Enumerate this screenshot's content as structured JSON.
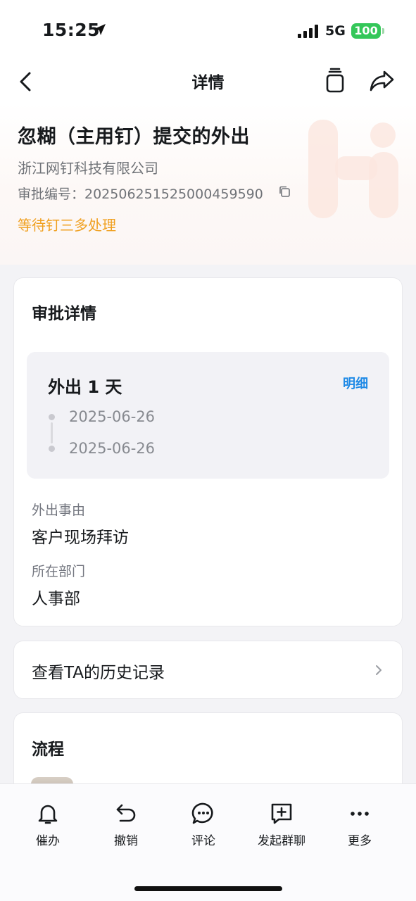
{
  "status_bar": {
    "time": "15:25",
    "network": "5G",
    "battery": "100"
  },
  "nav": {
    "title": "详情"
  },
  "header": {
    "title": "忽糊（主用钉）提交的外出",
    "company": "浙江网钉科技有限公司",
    "approval_number": "审批编号：2025062515250004595​90",
    "status": "等待钉三多处理",
    "status_color": "#f0a020"
  },
  "details": {
    "section_title": "审批详情",
    "leave_summary": "外出 1 天",
    "detail_link": "明细",
    "start_date": "2025-06-26",
    "end_date": "2025-06-26",
    "reason_label": "外出事由",
    "reason_value": "客户现场拜访",
    "department_label": "所在部门",
    "department_value": "人事部"
  },
  "history": {
    "label": "查看TA的历史记录"
  },
  "flow": {
    "section_title": "流程"
  },
  "toolbar": {
    "items": [
      {
        "label": "催办",
        "icon": "bell-icon"
      },
      {
        "label": "撤销",
        "icon": "undo-icon"
      },
      {
        "label": "评论",
        "icon": "comment-icon"
      },
      {
        "label": "发起群聊",
        "icon": "group-chat-icon"
      },
      {
        "label": "更多",
        "icon": "more-icon"
      }
    ]
  },
  "colors": {
    "accent_blue": "#1f8ae6",
    "battery_green": "#34c759"
  }
}
